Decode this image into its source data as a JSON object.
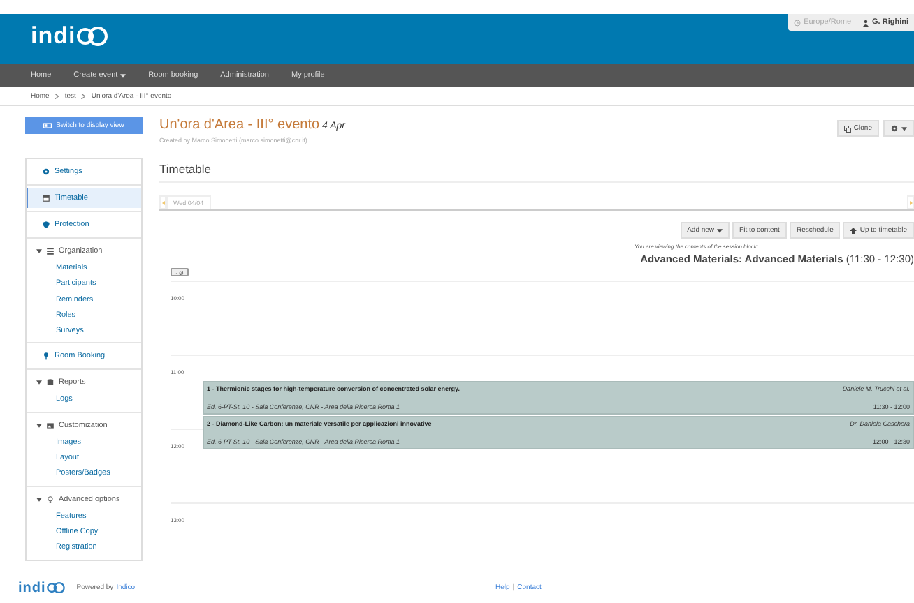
{
  "header": {
    "logo_text": "indi",
    "timezone": "Europe/Rome",
    "user": "G. Righini"
  },
  "nav": [
    {
      "label": "Home",
      "dropdown": false
    },
    {
      "label": "Create event",
      "dropdown": true
    },
    {
      "label": "Room booking",
      "dropdown": false
    },
    {
      "label": "Administration",
      "dropdown": false
    },
    {
      "label": "My profile",
      "dropdown": false
    }
  ],
  "breadcrumb": [
    "Home",
    "test",
    "Un'ora d'Area - III° evento"
  ],
  "switch_button": "Switch to display view",
  "event": {
    "title": "Un'ora d'Area - III° evento",
    "date": "4 Apr",
    "created_by": "Created by Marco Simonetti (marco.simonetti@cnr.it)",
    "clone": "Clone"
  },
  "sidebar": [
    {
      "kind": "link",
      "label": "Settings",
      "selected": false
    },
    {
      "kind": "link",
      "label": "Timetable",
      "selected": true
    },
    {
      "kind": "link",
      "label": "Protection",
      "selected": false
    },
    {
      "kind": "group",
      "label": "Organization",
      "expanded": true,
      "children": [
        "Materials",
        "Participants",
        "Reminders",
        "Roles",
        "Surveys"
      ]
    },
    {
      "kind": "link",
      "label": "Room Booking",
      "selected": false
    },
    {
      "kind": "group",
      "label": "Reports",
      "expanded": true,
      "children": [
        "Logs"
      ]
    },
    {
      "kind": "group",
      "label": "Customization",
      "expanded": true,
      "children": [
        "Images",
        "Layout",
        "Posters/Badges"
      ]
    },
    {
      "kind": "group",
      "label": "Advanced options",
      "expanded": true,
      "children": [
        "Features",
        "Offline Copy",
        "Registration"
      ]
    }
  ],
  "timetable": {
    "heading": "Timetable",
    "day_tab": "Wed 04/04",
    "toolbar": [
      {
        "label": "Add new",
        "dropdown": true
      },
      {
        "label": "Fit to content",
        "dropdown": false
      },
      {
        "label": "Reschedule",
        "dropdown": false
      },
      {
        "label": "Up to timetable",
        "dropdown": false
      }
    ],
    "note": "You are viewing the contents of the session block:",
    "session": "**Advanced Materials: Advanced Materials** (11:30 - 12:30)",
    "collapse": "- Ø",
    "hours": [
      "10:00",
      "11:00",
      "12:00",
      "13:00"
    ],
    "entries": [
      {
        "title": "1 - Thermionic stages for high-temperature conversion of concentrated solar energy.",
        "speaker": "Daniele M. Trucchi et al.",
        "room": "Ed. 6-PT-St. 10 - Sala Conferenze, CNR - Area della Ricerca Roma 1",
        "time": "11:30 - 12:00"
      },
      {
        "title": "2 - Diamond-Like Carbon: un materiale versatile per applicazioni innovative",
        "speaker": "Dr. Daniela Caschera",
        "room": "Ed. 6-PT-St. 10 - Sala Conferenze, CNR - Area della Ricerca Roma 1",
        "time": "12:00 - 12:30"
      }
    ]
  },
  "footer": {
    "logo_text": "indi",
    "powered": "Powered by",
    "link": "Indico",
    "help": "Help",
    "sep": "|",
    "contact": "Contact"
  }
}
